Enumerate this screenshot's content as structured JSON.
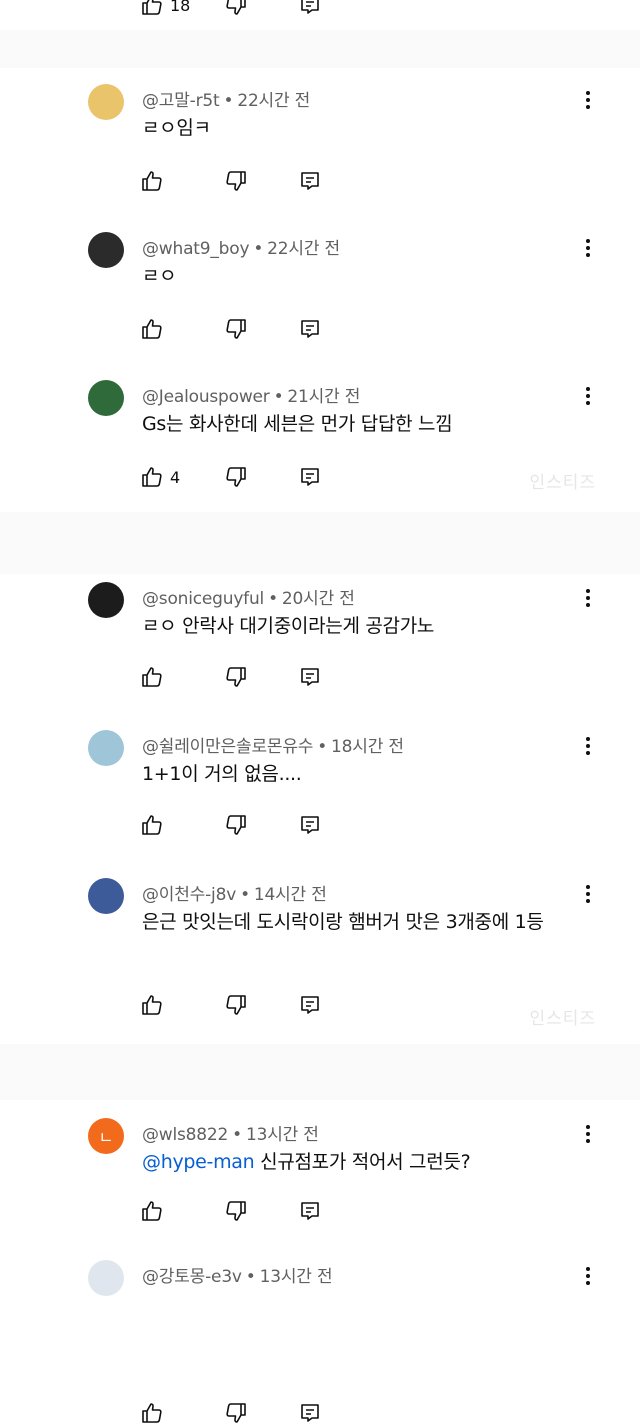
{
  "top_partial": {
    "like_count": "18"
  },
  "comments": [
    {
      "handle": "@고말-r5t",
      "time": "22시간 전",
      "text": "ㄹㅇ임ㅋ",
      "like_count": "",
      "avatar_color": "#e9c46a"
    },
    {
      "handle": "@what9_boy",
      "time": "22시간 전",
      "text": "ㄹㅇ",
      "like_count": "",
      "avatar_color": "#2b2b2b"
    },
    {
      "handle": "@Jealouspower",
      "time": "21시간 전",
      "text": "Gs는 화사한데 세븐은 먼가 답답한 느낌",
      "like_count": "4",
      "avatar_color": "#2f6b3a"
    },
    {
      "handle": "@soniceguyful",
      "time": "20시간 전",
      "text": "ㄹㅇ 안락사 대기중이라는게 공감가노",
      "like_count": "",
      "avatar_color": "#1c1c1c"
    },
    {
      "handle": "@쉴레이만은솔로몬유수",
      "time": "18시간 전",
      "text": "1+1이 거의 없음....",
      "like_count": "",
      "avatar_color": "#9fc5d9"
    },
    {
      "handle": "@이천수-j8v",
      "time": "14시간 전",
      "text": "은근 맛잇는데 도시락이랑 햄버거 맛은 3개중에 1등",
      "like_count": "",
      "avatar_color": "#3d5a99"
    },
    {
      "handle": "@wls8822",
      "time": "13시간 전",
      "mention": "@hype-man",
      "text": "신규점포가 적어서 그런듯?",
      "like_count": "",
      "avatar_color": "#f26b1d",
      "avatar_letter": "ㄴ"
    },
    {
      "handle": "@강토몽-e3v",
      "time": "13시간 전",
      "text": "",
      "like_count": "",
      "avatar_color": "#dfe6ee"
    }
  ],
  "separator": "•",
  "watermark": "인스티즈"
}
